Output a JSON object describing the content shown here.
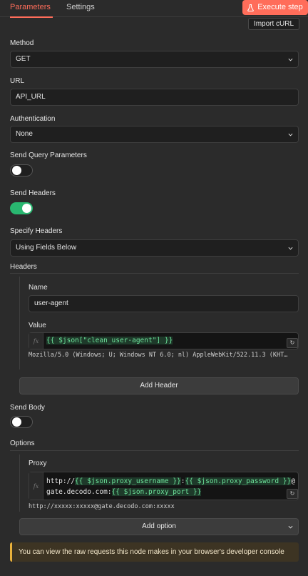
{
  "tabs": [
    "Parameters",
    "Settings"
  ],
  "execute_label": "Execute step",
  "import_label": "Import cURL",
  "method": {
    "label": "Method",
    "value": "GET"
  },
  "url": {
    "label": "URL",
    "value": "API_URL"
  },
  "auth": {
    "label": "Authentication",
    "value": "None"
  },
  "send_query": {
    "label": "Send Query Parameters",
    "on": false
  },
  "send_headers": {
    "label": "Send Headers",
    "on": true
  },
  "specify_headers": {
    "label": "Specify Headers",
    "value": "Using Fields Below"
  },
  "headers": {
    "label": "Headers",
    "name_label": "Name",
    "name_value": "user-agent",
    "value_label": "Value",
    "value_expr": "{{ $json[\"clean_user-agent\"] }}",
    "value_preview": "Mozilla/5.0 (Windows; U; Windows NT 6.0; nl) AppleWebKit/522.11.3 (KHT…",
    "add_label": "Add Header"
  },
  "send_body": {
    "label": "Send Body",
    "on": false
  },
  "options": {
    "label": "Options",
    "proxy_label": "Proxy",
    "proxy_line1": [
      "http://",
      "{{ $json.proxy_username }}",
      ":",
      "{{ $json.proxy_password }}",
      "@"
    ],
    "proxy_line2": [
      "gate.decodo.com:",
      "{{ $json.proxy_port }}"
    ],
    "proxy_preview": "http://xxxxx:xxxxx@gate.decodo.com:xxxxx",
    "add_label": "Add option"
  },
  "notice": "You can view the raw requests this node makes in your browser's developer console",
  "colors": {
    "accent": "#ff6d5a",
    "toggle_on": "#29b770",
    "expr_highlight": "#6ee39b",
    "notice_border": "#e9b13b"
  }
}
